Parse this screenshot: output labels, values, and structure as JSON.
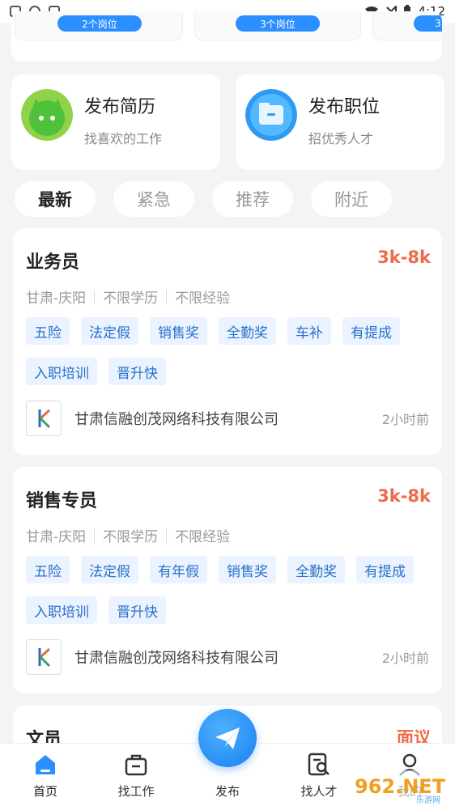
{
  "status": {
    "time": "4:12"
  },
  "top": {
    "buttons": [
      "2个岗位",
      "3个岗位",
      "3"
    ]
  },
  "publish": {
    "resume": {
      "title": "发布简历",
      "subtitle": "找喜欢的工作"
    },
    "job": {
      "title": "发布职位",
      "subtitle": "招优秀人才"
    }
  },
  "tabs": [
    {
      "label": "最新"
    },
    {
      "label": "紧急"
    },
    {
      "label": "推荐"
    },
    {
      "label": "附近"
    }
  ],
  "jobs": [
    {
      "title": "业务员",
      "salary": "3k-8k",
      "location": "甘肃-庆阳",
      "education": "不限学历",
      "experience": "不限经验",
      "tags": [
        "五险",
        "法定假",
        "销售奖",
        "全勤奖",
        "车补",
        "有提成",
        "入职培训",
        "晋升快"
      ],
      "company": "甘肃信融创茂网络科技有限公司",
      "posted": "2小时前"
    },
    {
      "title": "销售专员",
      "salary": "3k-8k",
      "location": "甘肃-庆阳",
      "education": "不限学历",
      "experience": "不限经验",
      "tags": [
        "五险",
        "法定假",
        "有年假",
        "销售奖",
        "全勤奖",
        "有提成",
        "入职培训",
        "晋升快"
      ],
      "company": "甘肃信融创茂网络科技有限公司",
      "posted": "2小时前"
    },
    {
      "title": "文员",
      "salary": "面议"
    }
  ],
  "nav": {
    "home": "首页",
    "find_job": "找工作",
    "publish": "发布",
    "find_talent": "找人才",
    "profile": "我的"
  },
  "watermark": {
    "text": "962.NET",
    "sub": "乐游网"
  },
  "colors": {
    "accent": "#2b8fff",
    "salary": "#ef6a4a",
    "tag_bg": "#eaf3ff",
    "tag_text": "#2a72c9"
  }
}
